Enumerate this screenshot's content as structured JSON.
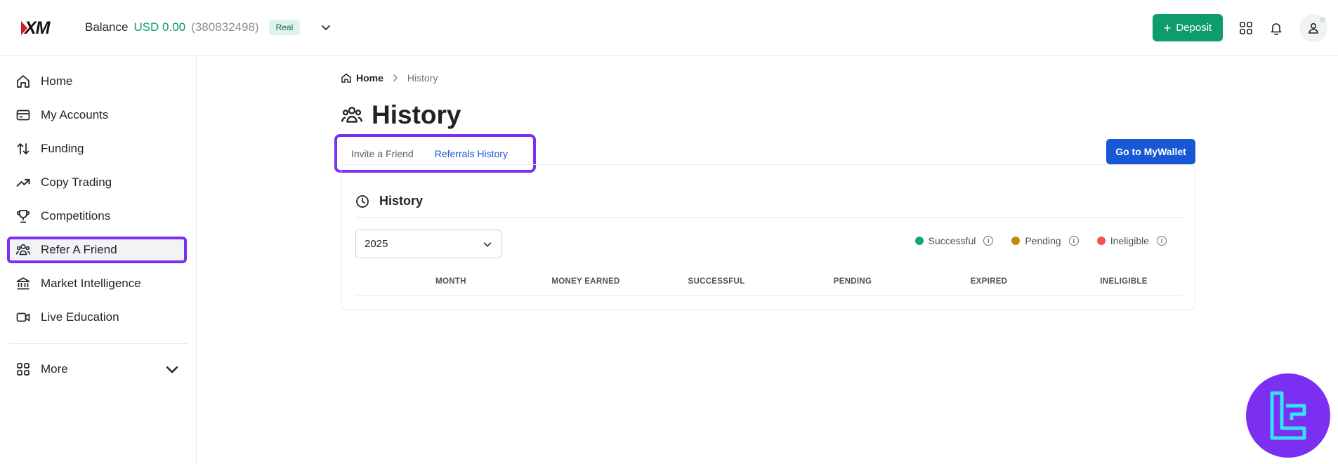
{
  "topbar": {
    "logo_text": "XM",
    "balance_label": "Balance",
    "balance_amount": "USD 0.00",
    "account_number": "(380832498)",
    "account_type": "Real",
    "deposit_label": "Deposit"
  },
  "sidebar": {
    "items": [
      {
        "label": "Home",
        "icon": "home-icon"
      },
      {
        "label": "My Accounts",
        "icon": "accounts-icon"
      },
      {
        "label": "Funding",
        "icon": "transfer-arrows-icon"
      },
      {
        "label": "Copy Trading",
        "icon": "trend-up-icon"
      },
      {
        "label": "Competitions",
        "icon": "trophy-icon"
      },
      {
        "label": "Refer A Friend",
        "icon": "people-icon",
        "active": true
      },
      {
        "label": "Market Intelligence",
        "icon": "bank-icon"
      },
      {
        "label": "Live Education",
        "icon": "video-icon"
      }
    ],
    "more_label": "More"
  },
  "breadcrumb": {
    "home": "Home",
    "current": "History"
  },
  "page": {
    "title": "History",
    "tabs": [
      {
        "label": "Invite a Friend",
        "active": false
      },
      {
        "label": "Referrals History",
        "active": true
      }
    ],
    "wallet_button": "Go to MyWallet"
  },
  "history_card": {
    "title": "History",
    "year_selected": "2025",
    "legend": [
      {
        "label": "Successful",
        "color": "#14a37a"
      },
      {
        "label": "Pending",
        "color": "#c8860f"
      },
      {
        "label": "Ineligible",
        "color": "#ef5350"
      }
    ],
    "columns": [
      "MONTH",
      "MONEY EARNED",
      "SUCCESSFUL",
      "PENDING",
      "EXPIRED",
      "INELIGIBLE"
    ]
  },
  "colors": {
    "accent_green": "#0e9b6d",
    "accent_blue": "#1858d6",
    "highlight_purple": "#7b2ff0"
  }
}
